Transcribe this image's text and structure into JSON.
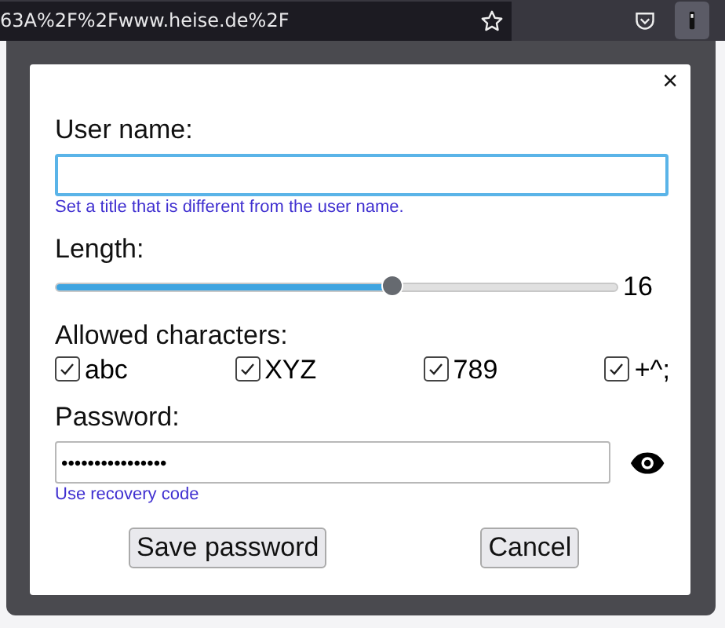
{
  "browser_toolbar": {
    "url": "63A%2F%2Fwww.heise.de%2F"
  },
  "dialog": {
    "close": "×",
    "user_name": {
      "label": "User name:",
      "focused": true,
      "hint": "Set a title that is different from the user name."
    },
    "length": {
      "label": "Length:",
      "level": 0.6,
      "reading": "16"
    },
    "allowed_characters": {
      "label": "Allowed characters:",
      "options": [
        {
          "label": "abc",
          "checked": true
        },
        {
          "label": "XYZ",
          "checked": true
        },
        {
          "label": "789",
          "checked": true
        },
        {
          "label": "+^;",
          "checked": true
        }
      ]
    },
    "password": {
      "label": "Password:",
      "value": "••••••••••••••••",
      "link": "Use recovery code"
    },
    "buttons": [
      "Save password",
      "Cancel"
    ]
  }
}
